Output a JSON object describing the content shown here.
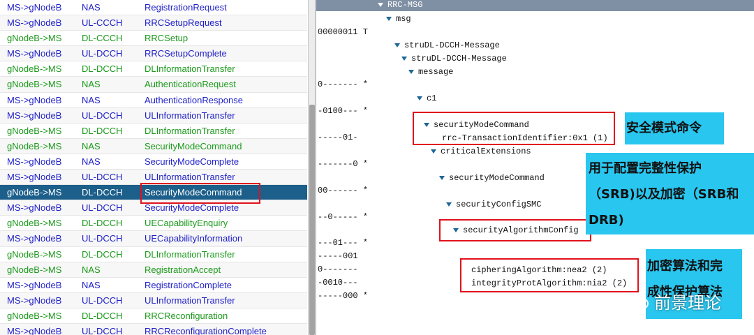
{
  "message_list": {
    "selected_index": 12,
    "rows": [
      {
        "direction": "MS->gNodeB",
        "channel": "NAS",
        "message": "RegistrationRequest",
        "type": "ul"
      },
      {
        "direction": "MS->gNodeB",
        "channel": "UL-CCCH",
        "message": "RRCSetupRequest",
        "type": "ul"
      },
      {
        "direction": "gNodeB->MS",
        "channel": "DL-CCCH",
        "message": "RRCSetup",
        "type": "dl"
      },
      {
        "direction": "MS->gNodeB",
        "channel": "UL-DCCH",
        "message": "RRCSetupComplete",
        "type": "ul"
      },
      {
        "direction": "gNodeB->MS",
        "channel": "DL-DCCH",
        "message": "DLInformationTransfer",
        "type": "dl"
      },
      {
        "direction": "gNodeB->MS",
        "channel": "NAS",
        "message": "AuthenticationRequest",
        "type": "dl"
      },
      {
        "direction": "MS->gNodeB",
        "channel": "NAS",
        "message": "AuthenticationResponse",
        "type": "ul"
      },
      {
        "direction": "MS->gNodeB",
        "channel": "UL-DCCH",
        "message": "ULInformationTransfer",
        "type": "ul"
      },
      {
        "direction": "gNodeB->MS",
        "channel": "DL-DCCH",
        "message": "DLInformationTransfer",
        "type": "dl"
      },
      {
        "direction": "gNodeB->MS",
        "channel": "NAS",
        "message": "SecurityModeCommand",
        "type": "dl"
      },
      {
        "direction": "MS->gNodeB",
        "channel": "NAS",
        "message": "SecurityModeComplete",
        "type": "ul"
      },
      {
        "direction": "MS->gNodeB",
        "channel": "UL-DCCH",
        "message": "ULInformationTransfer",
        "type": "ul"
      },
      {
        "direction": "gNodeB->MS",
        "channel": "DL-DCCH",
        "message": "SecurityModeCommand",
        "type": "dl"
      },
      {
        "direction": "MS->gNodeB",
        "channel": "UL-DCCH",
        "message": "SecurityModeComplete",
        "type": "ul"
      },
      {
        "direction": "gNodeB->MS",
        "channel": "DL-DCCH",
        "message": "UECapabilityEnquiry",
        "type": "dl"
      },
      {
        "direction": "MS->gNodeB",
        "channel": "UL-DCCH",
        "message": "UECapabilityInformation",
        "type": "ul"
      },
      {
        "direction": "gNodeB->MS",
        "channel": "DL-DCCH",
        "message": "DLInformationTransfer",
        "type": "dl"
      },
      {
        "direction": "gNodeB->MS",
        "channel": "NAS",
        "message": "RegistrationAccept",
        "type": "dl"
      },
      {
        "direction": "MS->gNodeB",
        "channel": "NAS",
        "message": "RegistrationComplete",
        "type": "ul"
      },
      {
        "direction": "MS->gNodeB",
        "channel": "UL-DCCH",
        "message": "ULInformationTransfer",
        "type": "ul"
      },
      {
        "direction": "gNodeB->MS",
        "channel": "DL-DCCH",
        "message": "RRCReconfiguration",
        "type": "dl"
      },
      {
        "direction": "MS->gNodeB",
        "channel": "UL-DCCH",
        "message": "RRCReconfigurationComplete",
        "type": "ul"
      }
    ]
  },
  "decode_tree": {
    "header": "RRC-MSG",
    "nodes": [
      {
        "label": "msg",
        "expandable": true,
        "bits": ""
      },
      {
        "label": "struDL-DCCH-Message",
        "expandable": true,
        "bits": "00000011 T"
      },
      {
        "label": "struDL-DCCH-Message",
        "expandable": true,
        "bits": ""
      },
      {
        "label": "message",
        "expandable": true,
        "bits": ""
      },
      {
        "label": "c1",
        "expandable": true,
        "bits": "0------- *"
      },
      {
        "label": "securityModeCommand",
        "expandable": true,
        "bits": "-0100--- *"
      },
      {
        "label": "rrc-TransactionIdentifier:0x1 (1)",
        "expandable": false,
        "bits": "-----01-"
      },
      {
        "label": "criticalExtensions",
        "expandable": true,
        "bits": ""
      },
      {
        "label": "securityModeCommand",
        "expandable": true,
        "bits": "-------0 *"
      },
      {
        "label": "securityConfigSMC",
        "expandable": true,
        "bits": "00------ *"
      },
      {
        "label": "securityAlgorithmConfig",
        "expandable": true,
        "bits": "--0----- *"
      },
      {
        "label": "cipheringAlgorithm:nea2 (2)",
        "expandable": false,
        "bits": "---01--- *"
      },
      {
        "label": "integrityProtAlgorithm:nia2 (2)",
        "expandable": false,
        "bits": "-----001"
      }
    ],
    "extra_bits": [
      "0-------",
      "-0010---",
      "-----000 *"
    ]
  },
  "annotations": {
    "callout_1": "安全模式命令",
    "callout_2_line1": "用于配置完整性保护",
    "callout_2_line2": "（SRB)以及加密（SRB和",
    "callout_2_line3": "DRB)",
    "callout_3_line1": "加密算法和完",
    "callout_3_line2": "成性保护算法"
  },
  "watermark": {
    "text": "前景理论",
    "icon": "wechat-icon"
  },
  "colors": {
    "uplink": "#1f1fc8",
    "downlink": "#1c9a1c",
    "selected": "#1c5f8b",
    "highlight": "#e0111b",
    "callout": "#29c6ef",
    "tree_arrow": "#1e6696"
  }
}
